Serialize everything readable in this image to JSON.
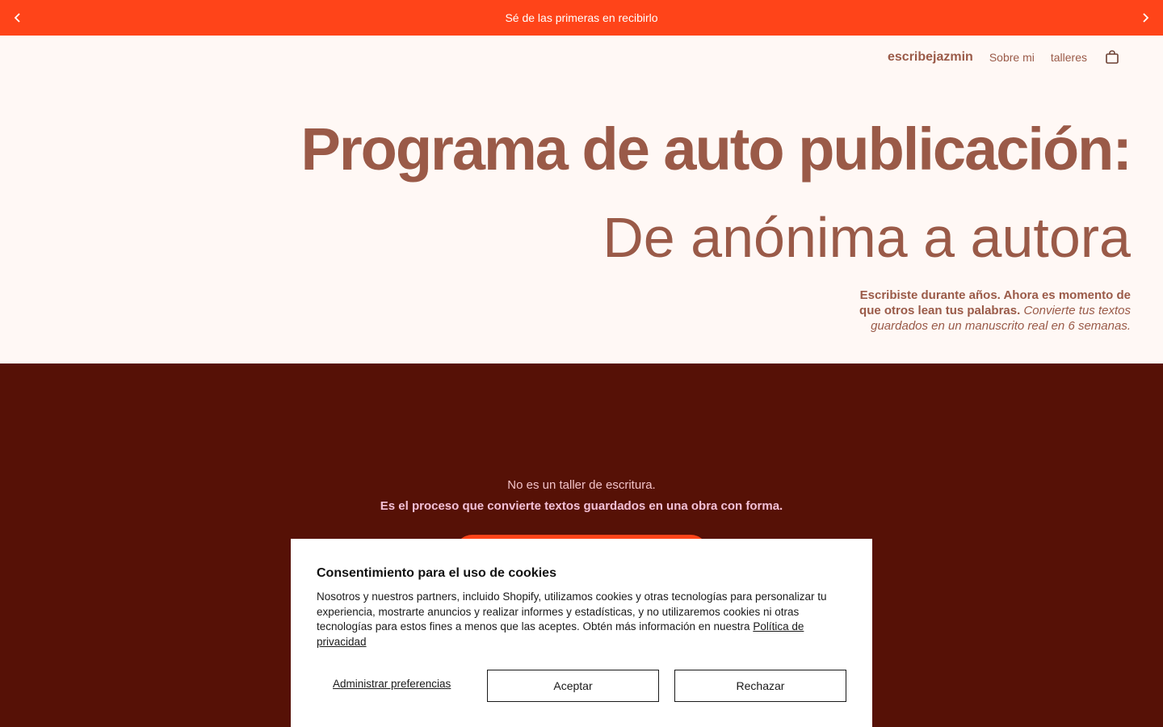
{
  "announcement": {
    "text": "Sé de las primeras en recibirlo"
  },
  "nav": {
    "brand": "escribejazmin",
    "links": [
      "Sobre mi",
      "talleres"
    ]
  },
  "hero": {
    "title": "Programa de auto publicación:",
    "subtitle": "De anónima a autora",
    "desc_bold": "Escribiste durante años. Ahora es momento de que otros lean tus palabras.",
    "desc_italic": "Convierte tus textos guardados en un manuscrito real en 6 semanas."
  },
  "section": {
    "line1": "No es un taller de escritura.",
    "line2": "Es el proceso que convierte textos guardados en una obra con forma."
  },
  "cookie": {
    "title": "Consentimiento para el uso de cookies",
    "text": "Nosotros y nuestros partners, incluido Shopify, utilizamos cookies y otras tecnologías para personalizar tu experiencia, mostrarte anuncios y realizar informes y estadísticas, y no utilizaremos cookies ni otras tecnologías para estos fines a menos que las aceptes. Obtén más información en nuestra",
    "link": "Política de privacidad",
    "manage": "Administrar preferencias",
    "accept": "Aceptar",
    "reject": "Rechazar"
  },
  "colors": {
    "accent": "#ff4419",
    "brown": "#9a5a48",
    "dark": "#561106",
    "bg": "#fff8f5"
  },
  "icons": {
    "prev": "chevron-left-icon",
    "next": "chevron-right-icon",
    "cart": "bag-icon"
  }
}
